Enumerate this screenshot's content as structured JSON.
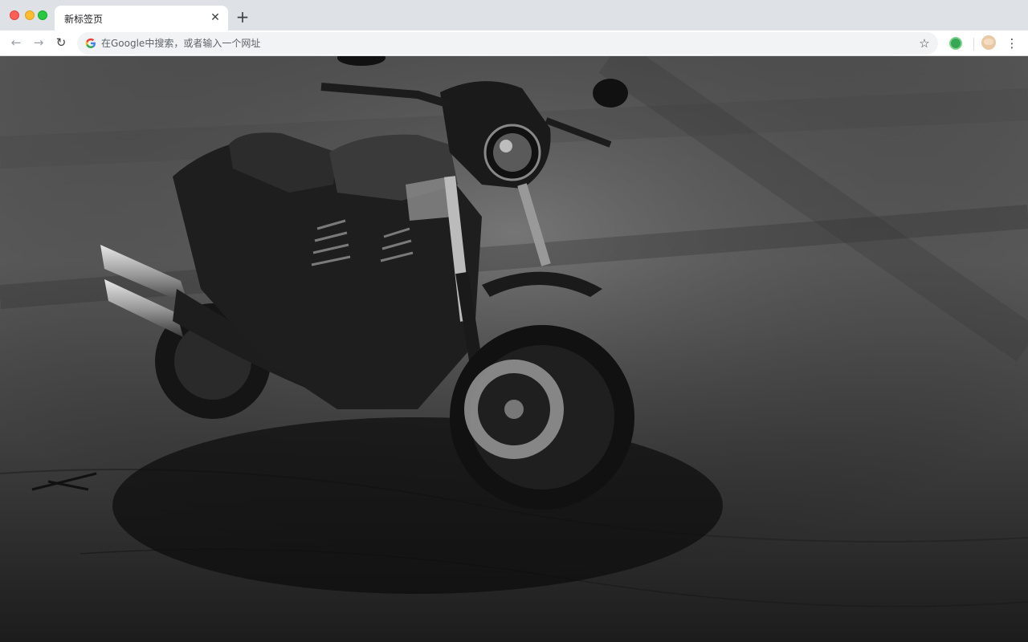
{
  "browser": {
    "tab": {
      "title": "新标签页",
      "close_icon": "close-icon"
    },
    "new_tab_icon": "plus-icon",
    "toolbar": {
      "back_icon": "arrow-left-icon",
      "forward_icon": "arrow-right-icon",
      "reload_icon": "reload-icon",
      "omnibox_placeholder": "在Google中搜索，或者输入一个网址",
      "bookmark_icon": "star-icon",
      "menu_icon": "more-vertical-icon"
    }
  },
  "page": {
    "background": "black-and-white photo of a motorcycle on a cracked asphalt road"
  }
}
